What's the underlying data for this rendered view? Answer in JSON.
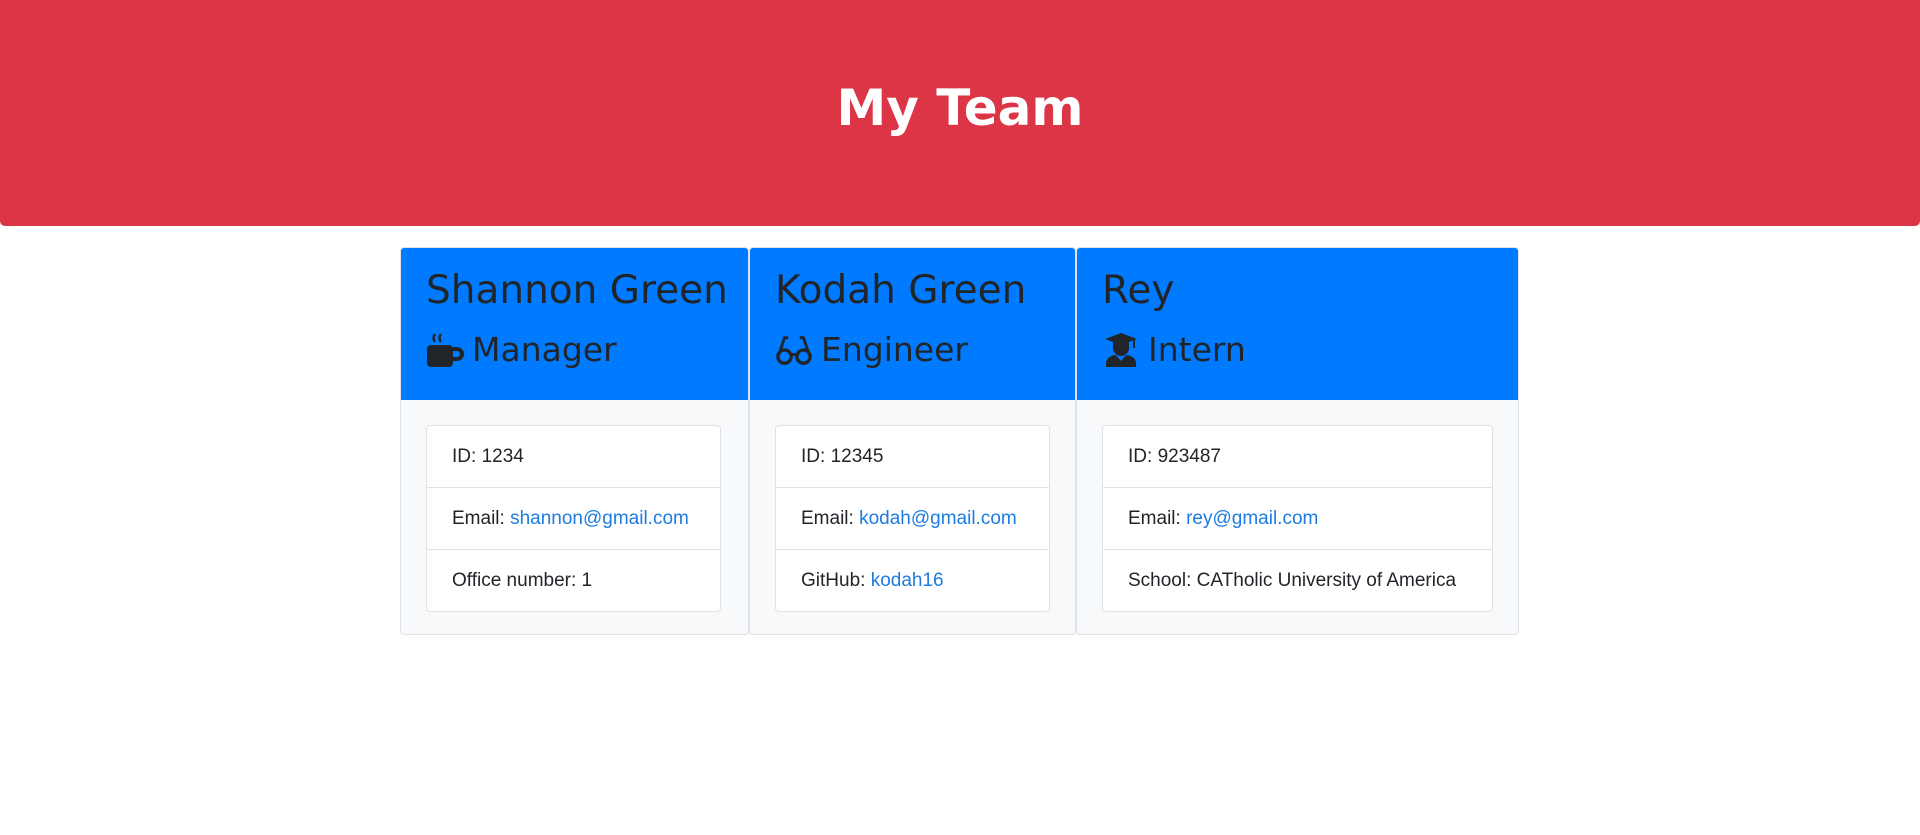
{
  "header": {
    "title": "My Team"
  },
  "employees": [
    {
      "name": "Shannon Green",
      "role": "Manager",
      "role_icon": "coffee-mug-icon",
      "id_label": "ID: ",
      "id": "1234",
      "email_label": "Email: ",
      "email": "shannon@gmail.com",
      "extra_label": "Office number: ",
      "extra_value": "1"
    },
    {
      "name": "Kodah Green",
      "role": "Engineer",
      "role_icon": "glasses-icon",
      "id_label": "ID: ",
      "id": "12345",
      "email_label": "Email: ",
      "email": "kodah@gmail.com",
      "extra_label": "GitHub: ",
      "extra_value": "kodah16"
    },
    {
      "name": "Rey",
      "role": "Intern",
      "role_icon": "graduate-icon",
      "id_label": "ID: ",
      "id": "923487",
      "email_label": "Email: ",
      "email": "rey@gmail.com",
      "extra_label": "School: ",
      "extra_value": "CATholic University of America"
    }
  ],
  "colors": {
    "header_bg": "#dc3545",
    "card_header_bg": "#007bff",
    "link": "#1e7be0"
  }
}
